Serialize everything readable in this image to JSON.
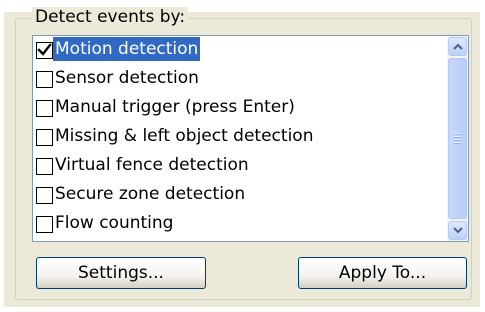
{
  "group": {
    "legend": "Detect events by:"
  },
  "event_list": {
    "items": [
      {
        "label": "Motion detection",
        "checked": true,
        "selected": true
      },
      {
        "label": "Sensor detection",
        "checked": false,
        "selected": false
      },
      {
        "label": "Manual trigger (press Enter)",
        "checked": false,
        "selected": false
      },
      {
        "label": "Missing & left object detection",
        "checked": false,
        "selected": false
      },
      {
        "label": "Virtual fence detection",
        "checked": false,
        "selected": false
      },
      {
        "label": "Secure zone detection",
        "checked": false,
        "selected": false
      },
      {
        "label": "Flow counting",
        "checked": false,
        "selected": false
      }
    ]
  },
  "buttons": {
    "settings": "Settings...",
    "apply_to": "Apply To..."
  },
  "colors": {
    "selection_bg": "#316ac5",
    "window_bg": "#ece9d8",
    "button_border": "#003c74"
  },
  "icons": {
    "scroll_up": "chevron-up-icon",
    "scroll_down": "chevron-down-icon",
    "check": "checkmark-icon"
  }
}
